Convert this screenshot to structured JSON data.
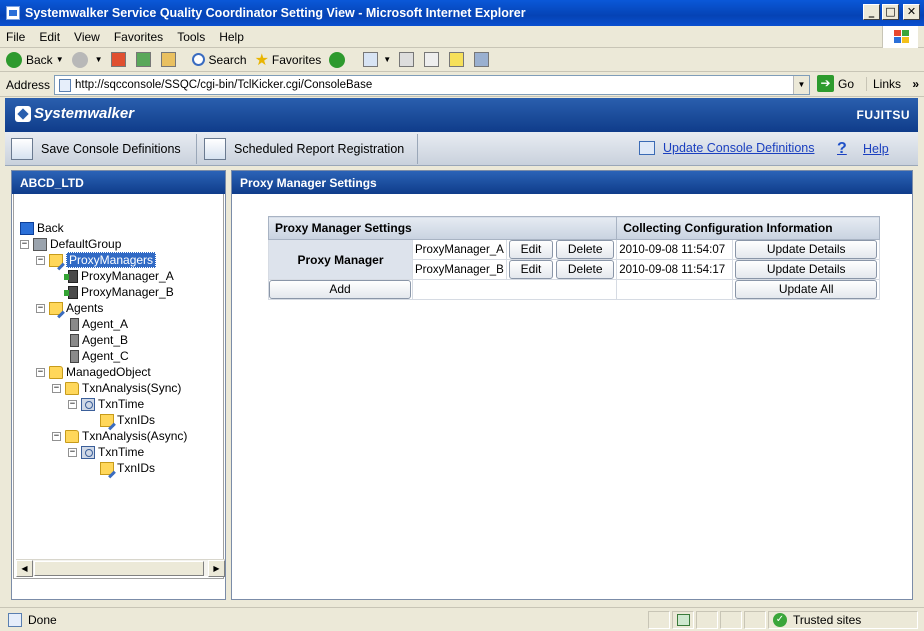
{
  "window": {
    "title": "Systemwalker Service Quality Coordinator Setting View - Microsoft Internet Explorer",
    "min": "_",
    "max": "□",
    "close": "✕"
  },
  "menu": [
    {
      "label": "File"
    },
    {
      "label": "Edit"
    },
    {
      "label": "View"
    },
    {
      "label": "Favorites"
    },
    {
      "label": "Tools"
    },
    {
      "label": "Help"
    }
  ],
  "toolbar": {
    "back": "Back",
    "search": "Search",
    "favorites": "Favorites"
  },
  "address": {
    "label": "Address",
    "url": "http://sqcconsole/SSQC/cgi-bin/TclKicker.cgi/ConsoleBase",
    "go": "Go",
    "links": "Links"
  },
  "brand": {
    "logo": "Systemwalker",
    "vendor": "FUJITSU"
  },
  "actions": {
    "save": "Save Console Definitions",
    "schedule": "Scheduled Report Registration",
    "update": "Update Console Definitions",
    "help": "Help"
  },
  "tree": {
    "title": "ABCD_LTD",
    "nodes": [
      {
        "label": "Back"
      },
      {
        "label": "DefaultGroup"
      },
      {
        "label": "ProxyManagers"
      },
      {
        "label": "ProxyManager_A"
      },
      {
        "label": "ProxyManager_B"
      },
      {
        "label": "Agents"
      },
      {
        "label": "Agent_A"
      },
      {
        "label": "Agent_B"
      },
      {
        "label": "Agent_C"
      },
      {
        "label": "ManagedObject"
      },
      {
        "label": "TxnAnalysis(Sync)"
      },
      {
        "label": "TxnTime"
      },
      {
        "label": "TxnIDs"
      },
      {
        "label": "TxnAnalysis(Async)"
      },
      {
        "label": "TxnTime"
      },
      {
        "label": "TxnIDs"
      }
    ]
  },
  "main": {
    "title": "Proxy Manager Settings",
    "table": {
      "col1": "Proxy Manager Settings",
      "col2": "Collecting Configuration Information",
      "row_label": "Proxy Manager",
      "rows": [
        {
          "name": "ProxyManager_A",
          "edit": "Edit",
          "delete": "Delete",
          "time": "2010-09-08 11:54:07",
          "update": "Update Details"
        },
        {
          "name": "ProxyManager_B",
          "edit": "Edit",
          "delete": "Delete",
          "time": "2010-09-08 11:54:17",
          "update": "Update Details"
        }
      ],
      "add": "Add",
      "update_all": "Update All"
    }
  },
  "status": {
    "text": "Done",
    "zone": "Trusted sites"
  }
}
